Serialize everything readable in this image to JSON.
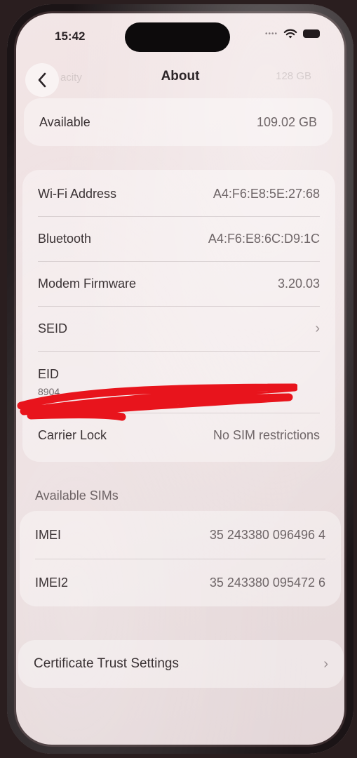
{
  "status_bar": {
    "time": "15:42"
  },
  "nav": {
    "title": "About",
    "back_icon": "chevron-left-icon",
    "ghost_left": "acity",
    "ghost_right": "128 GB"
  },
  "storage_group": {
    "rows": [
      {
        "label": "Available",
        "value": "109.02 GB"
      }
    ]
  },
  "network_group": {
    "rows": [
      {
        "label": "Wi-Fi Address",
        "value": "A4:F6:E8:5E:27:68"
      },
      {
        "label": "Bluetooth",
        "value": "A4:F6:E8:6C:D9:1C"
      },
      {
        "label": "Modem Firmware",
        "value": "3.20.03"
      },
      {
        "label": "SEID",
        "chevron": "chevron-right-icon"
      },
      {
        "label": "EID",
        "value": "8904"
      },
      {
        "label": "Carrier Lock",
        "value": "No SIM restrictions"
      }
    ]
  },
  "sims_group": {
    "header": "Available SIMs",
    "rows": [
      {
        "label": "IMEI",
        "value": "35 243380 096496 4"
      },
      {
        "label": "IMEI2",
        "value": "35 243380 095472 6"
      }
    ]
  },
  "cert_group": {
    "rows": [
      {
        "label": "Certificate Trust Settings",
        "chevron": "chevron-right-icon"
      }
    ]
  },
  "colors": {
    "redaction": "#e8141c",
    "background": "#efe2e3"
  }
}
